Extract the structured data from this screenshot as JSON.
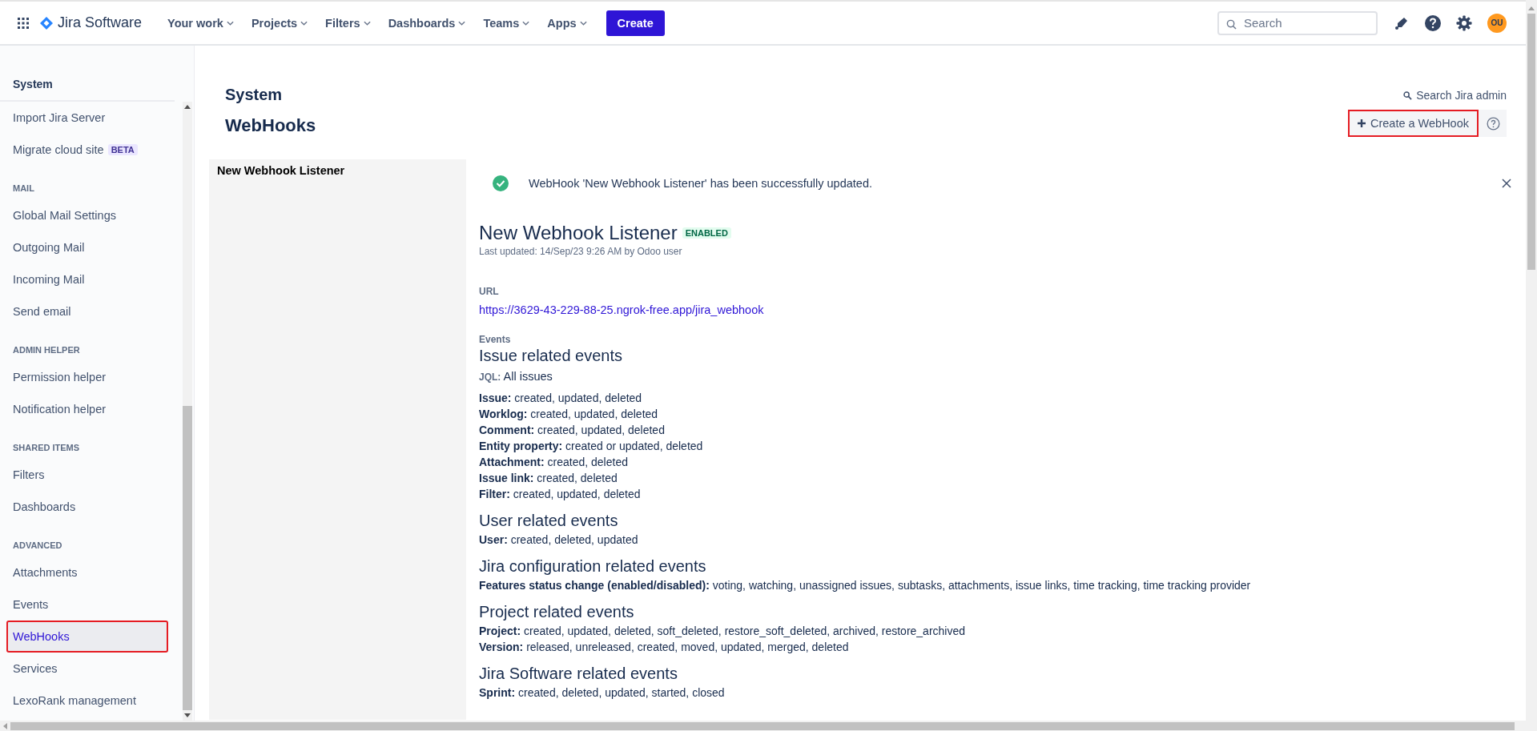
{
  "topbar": {
    "product": "Jira Software",
    "nav": [
      {
        "label": "Your work"
      },
      {
        "label": "Projects"
      },
      {
        "label": "Filters"
      },
      {
        "label": "Dashboards"
      },
      {
        "label": "Teams"
      },
      {
        "label": "Apps"
      }
    ],
    "create": "Create",
    "search": {
      "placeholder": "Search"
    },
    "avatar": "OU"
  },
  "sidebar": {
    "title": "System",
    "items": [
      {
        "kind": "item",
        "label": "Import Jira Server",
        "selected": false
      },
      {
        "kind": "item",
        "label": "Migrate cloud site",
        "badge": "BETA",
        "selected": false
      },
      {
        "kind": "heading",
        "label": "MAIL"
      },
      {
        "kind": "item",
        "label": "Global Mail Settings",
        "selected": false
      },
      {
        "kind": "item",
        "label": "Outgoing Mail",
        "selected": false
      },
      {
        "kind": "item",
        "label": "Incoming Mail",
        "selected": false
      },
      {
        "kind": "item",
        "label": "Send email",
        "selected": false
      },
      {
        "kind": "heading",
        "label": "ADMIN HELPER"
      },
      {
        "kind": "item",
        "label": "Permission helper",
        "selected": false
      },
      {
        "kind": "item",
        "label": "Notification helper",
        "selected": false
      },
      {
        "kind": "heading",
        "label": "SHARED ITEMS"
      },
      {
        "kind": "item",
        "label": "Filters",
        "selected": false
      },
      {
        "kind": "item",
        "label": "Dashboards",
        "selected": false
      },
      {
        "kind": "heading",
        "label": "ADVANCED"
      },
      {
        "kind": "item",
        "label": "Attachments",
        "selected": false
      },
      {
        "kind": "item",
        "label": "Events",
        "selected": false
      },
      {
        "kind": "item",
        "label": "WebHooks",
        "selected": true,
        "outlined": true
      },
      {
        "kind": "item",
        "label": "Services",
        "selected": false
      },
      {
        "kind": "item",
        "label": "LexoRank management",
        "selected": false
      }
    ]
  },
  "page": {
    "breadcrumb": "System",
    "title": "WebHooks",
    "search_admin": "Search Jira admin",
    "create_button": {
      "label": "Create a WebHook",
      "outlined": true
    }
  },
  "listeners": [
    {
      "name": "New Webhook Listener",
      "selected": true
    }
  ],
  "message": "WebHook 'New Webhook Listener' has been successfully updated.",
  "detail": {
    "name": "New Webhook Listener",
    "status": "ENABLED",
    "updated": "Last updated: 14/Sep/23 9:26 AM by Odoo user",
    "url_label": "URL",
    "url": "https://3629-43-229-88-25.ngrok-free.app/jira_webhook",
    "events_label": "Events",
    "groups": [
      {
        "heading": "Issue related events",
        "jql_label": "JQL:",
        "jql": "All issues",
        "lines": [
          {
            "label": "Issue:",
            "value": "created, updated, deleted"
          },
          {
            "label": "Worklog:",
            "value": "created, updated, deleted"
          },
          {
            "label": "Comment:",
            "value": "created, updated, deleted"
          },
          {
            "label": "Entity property:",
            "value": "created or updated, deleted"
          },
          {
            "label": "Attachment:",
            "value": "created, deleted"
          },
          {
            "label": "Issue link:",
            "value": "created, deleted"
          },
          {
            "label": "Filter:",
            "value": "created, updated, deleted"
          }
        ]
      },
      {
        "heading": "User related events",
        "lines": [
          {
            "label": "User:",
            "value": "created, deleted, updated"
          }
        ]
      },
      {
        "heading": "Jira configuration related events",
        "lines": [
          {
            "label": "Features status change (enabled/disabled):",
            "value": "voting, watching, unassigned issues, subtasks, attachments, issue links, time tracking, time tracking provider"
          }
        ]
      },
      {
        "heading": "Project related events",
        "lines": [
          {
            "label": "Project:",
            "value": "created, updated, deleted, soft_deleted, restore_soft_deleted, archived, restore_archived"
          },
          {
            "label": "Version:",
            "value": "released, unreleased, created, moved, updated, merged, deleted"
          }
        ]
      },
      {
        "heading": "Jira Software related events",
        "lines": [
          {
            "label": "Sprint:",
            "value": "created, deleted, updated, started, closed"
          }
        ]
      }
    ]
  }
}
